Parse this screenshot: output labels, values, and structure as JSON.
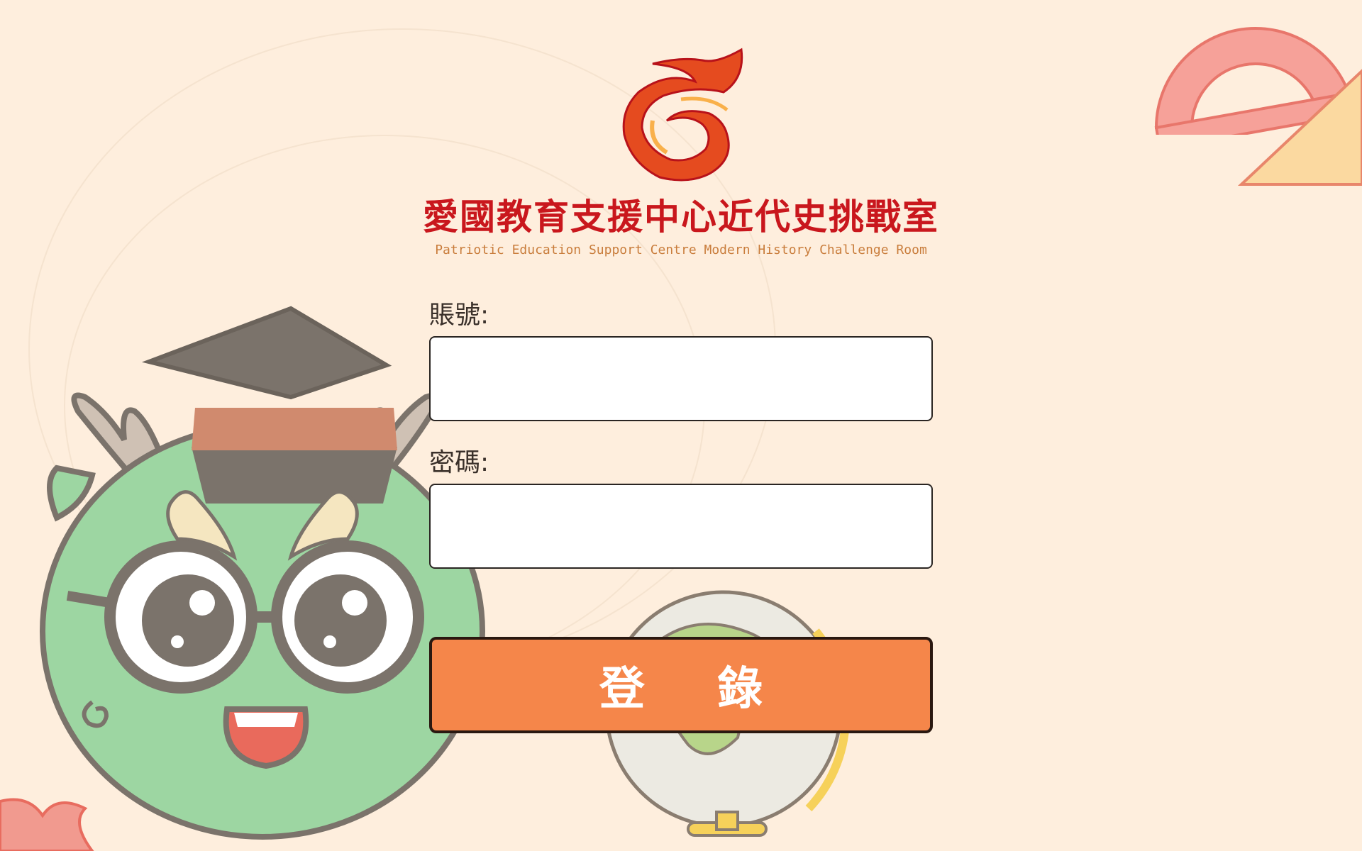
{
  "header": {
    "title_zh": "愛國教育支援中心近代史挑戰室",
    "title_en": "Patriotic Education Support Centre Modern History Challenge Room"
  },
  "form": {
    "account_label": "賬號:",
    "password_label": "密碼:",
    "account_value": "",
    "password_value": "",
    "login_label": "登 錄"
  },
  "colors": {
    "background": "#feeedd",
    "title_red": "#c9171d",
    "subtitle_brown": "#c97d3c",
    "button_orange": "#f5864a",
    "mascot_green": "#9dd6a2"
  },
  "icons": [
    "logo-emblem-icon",
    "dragon-mascot-icon",
    "globe-icon",
    "protractor-icon",
    "set-square-icon",
    "flame-icon"
  ]
}
